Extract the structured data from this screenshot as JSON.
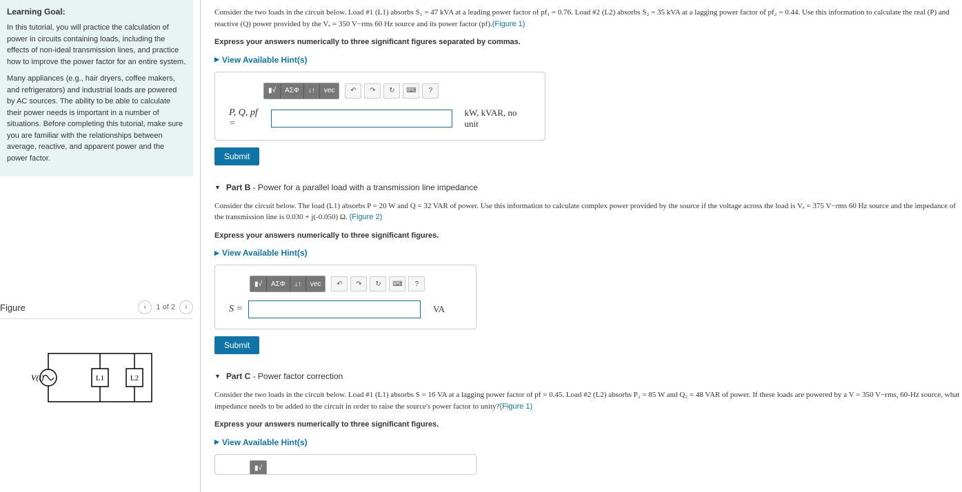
{
  "goal": {
    "heading": "Learning Goal:",
    "p1": "In this tutorial, you will practice the calculation of power in circuits containing loads, including the effects of non-ideal transmission lines, and practice how to improve the power factor for an entire system.",
    "p2": "Many appliances (e.g., hair dryers, coffee makers, and refrigerators) and industrial loads are powered by AC sources. The ability to be able to calculate their power needs is important in a number of situations. Before completing this tutorial, make sure you are familiar with the relationships between average, reactive, and apparent power and the power factor."
  },
  "figure": {
    "title": "Figure",
    "counter": "1 of 2",
    "vt": "V(t)",
    "l1": "L1",
    "l2": "L2"
  },
  "partA": {
    "text_pre": "Consider the two loads in the circuit below. Load #1 (L1) absorbs S₁ = 47 kVA at a leading power factor of pf₁ = 0.76. Load #2 (L2) absorbs S₂ = 35 kVA at a lagging power factor of pf₂ = 0.44. Use this information to calculate the real (P) and reactive (Q) power provided by the Vₑ = 350 V−rms 60 Hz source and its power factor (pf).",
    "fig_link": "(Figure 1)",
    "instruct": "Express your answers numerically to three significant figures separated by commas.",
    "hints": "View Available Hint(s)",
    "label": "P, Q, pf =",
    "unit": "kW, kVAR, no unit",
    "submit": "Submit"
  },
  "partB": {
    "header_bold": "Part B",
    "header_rest": " - Power for a parallel load with a transmission line impedance",
    "text": "Consider the circuit below. The load (L1) absorbs P = 20 W and Q = 32 VAR of power. Use this information to calculate complex power provided by the source if the voltage across the load is Vₑ = 375 V−rms 60 Hz source and the impedance of the transmission line is 0.030 + j(-0.050) Ω. ",
    "fig_link": "(Figure 2)",
    "instruct": "Express your answers numerically to three significant figures.",
    "hints": "View Available Hint(s)",
    "label": "S =",
    "unit": "VA",
    "submit": "Submit"
  },
  "partC": {
    "header_bold": "Part C",
    "header_rest": " - Power factor correction",
    "text": "Consider the two loads in the circuit below. Load #1 (L1) absorbs S = 16 VA at a lagging power factor of pf = 0.45. Load #2 (L2) absorbs P₂ = 85 W and Q₂ = 48 VAR of power. If these loads are powered by a V = 350 V−rms, 60-Hz source, what impedance needs to be added to the circuit in order to raise the source's power factor to unity?",
    "fig_link": "(Figure 1)",
    "instruct": "Express your answers numerically to three significant figures.",
    "hints": "View Available Hint(s)"
  },
  "toolbar": {
    "tmpl": "▮√",
    "greek": "ΑΣΦ",
    "sub": "↓↑",
    "vec": "vec",
    "undo": "↶",
    "redo": "↷",
    "reset": "↻",
    "kb": "⌨",
    "help": "?"
  }
}
